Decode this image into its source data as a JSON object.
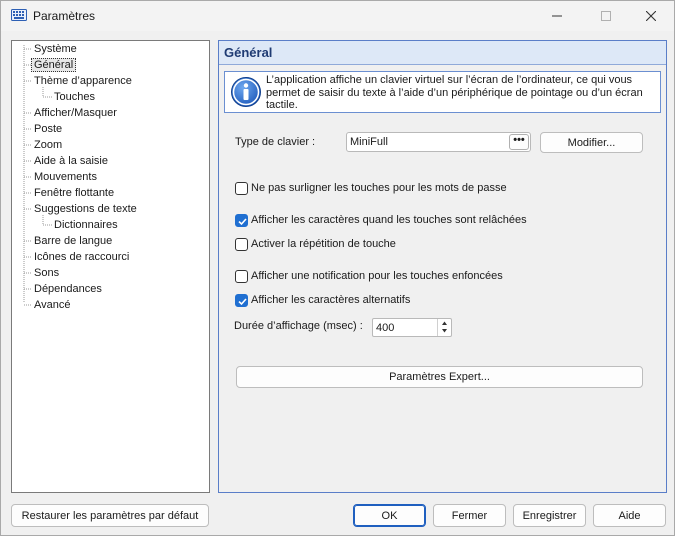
{
  "window": {
    "title": "Paramètres"
  },
  "tree": {
    "items": [
      {
        "label": "Système",
        "level": 0
      },
      {
        "label": "Général",
        "level": 0,
        "selected": true
      },
      {
        "label": "Thème d’apparence",
        "level": 0
      },
      {
        "label": "Touches",
        "level": 1
      },
      {
        "label": "Afficher/Masquer",
        "level": 0
      },
      {
        "label": "Poste",
        "level": 0
      },
      {
        "label": "Zoom",
        "level": 0
      },
      {
        "label": "Aide à la saisie",
        "level": 0
      },
      {
        "label": "Mouvements",
        "level": 0
      },
      {
        "label": "Fenêtre flottante",
        "level": 0
      },
      {
        "label": "Suggestions de texte",
        "level": 0
      },
      {
        "label": "Dictionnaires",
        "level": 1
      },
      {
        "label": "Barre de langue",
        "level": 0
      },
      {
        "label": "Icônes de raccourci",
        "level": 0
      },
      {
        "label": "Sons",
        "level": 0
      },
      {
        "label": "Dépendances",
        "level": 0
      },
      {
        "label": "Avancé",
        "level": 0
      }
    ]
  },
  "panel": {
    "title": "Général",
    "info": "L’application affiche un clavier virtuel sur l’écran de l’ordinateur, ce qui vous permet de saisir du texte à l’aide d’un périphérique de pointage ou d’un écran tactile.",
    "keyboard_type_label": "Type de clavier :",
    "keyboard_type_value": "MiniFull",
    "ellipsis_label": "•••",
    "modify_label": "Modifier...",
    "options": {
      "no_highlight_password": {
        "label": "Ne pas surligner les touches pour les mots de passe",
        "checked": false
      },
      "show_chars_released": {
        "label": "Afficher les caractères quand les touches sont relâchées",
        "checked": true
      },
      "key_repeat": {
        "label": "Activer la répétition de touche",
        "checked": false
      },
      "notify_pressed": {
        "label": "Afficher une notification pour les touches enfoncées",
        "checked": false
      },
      "show_alternates": {
        "label": "Afficher les caractères alternatifs",
        "checked": true
      }
    },
    "display_duration_label": "Durée d’affichage (msec) :",
    "display_duration_value": "400",
    "expert_label": "Paramètres Expert..."
  },
  "footer": {
    "restore_label": "Restaurer les paramètres par défaut",
    "ok_label": "OK",
    "close_label": "Fermer",
    "save_label": "Enregistrer",
    "help_label": "Aide"
  },
  "colors": {
    "accent": "#1f6fd1",
    "panel_border": "#5a7ec8",
    "panel_header_bg": "#dde8f7",
    "panel_title": "#1f3b73"
  },
  "icons": {
    "app": "keyboard-icon",
    "info": "info-icon",
    "check": "checkmark-icon"
  }
}
